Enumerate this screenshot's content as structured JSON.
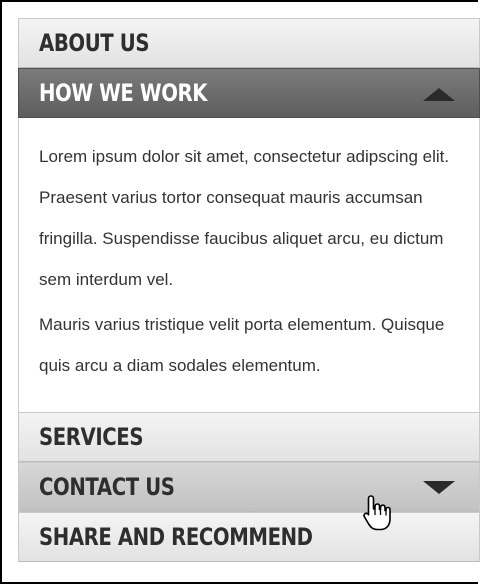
{
  "accordion": {
    "items": [
      {
        "label": "ABOUT US"
      },
      {
        "label": "HOW WE WORK"
      },
      {
        "label": "SERVICES"
      },
      {
        "label": "CONTACT US"
      },
      {
        "label": "SHARE AND RECOMMEND"
      }
    ],
    "expanded_item": "HOW WE WORK",
    "panel": {
      "paragraph1": "Lorem ipsum dolor sit amet, consectetur adipscing elit. Praesent varius tortor consequat mauris accumsan fringilla. Suspendisse faucibus aliquet arcu, eu dictum sem interdum vel.",
      "paragraph2": "Mauris varius tristique velit porta elementum. Quisque quis arcu a diam sodales elementum."
    }
  },
  "colors": {
    "active_header": "#666666",
    "header": "#e8e8e8",
    "hover_header": "#cccccc",
    "text": "#333333"
  },
  "icons": {
    "expanded_arrow": "triangle-up-icon",
    "collapsed_arrow": "triangle-down-icon",
    "cursor": "hand-pointer-icon"
  }
}
